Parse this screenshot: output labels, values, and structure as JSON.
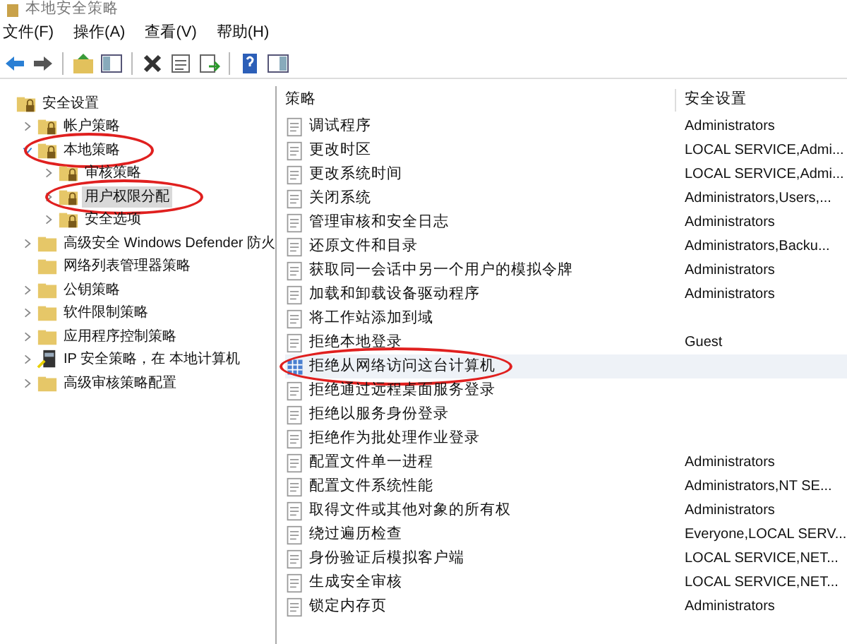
{
  "window": {
    "title": "本地安全策略"
  },
  "menu": [
    "文件(F)",
    "操作(A)",
    "查看(V)",
    "帮助(H)"
  ],
  "tree": [
    {
      "label": "安全设置",
      "kind": "lock",
      "selected": false,
      "circled": false,
      "children": [
        {
          "label": "帐户策略",
          "kind": "lock",
          "expanded": false,
          "selected": false,
          "circled": false
        },
        {
          "label": "本地策略",
          "kind": "lock",
          "expanded": true,
          "selected": false,
          "circled": true,
          "children": [
            {
              "label": "审核策略",
              "kind": "lock",
              "expanded": false,
              "selected": false,
              "circled": false
            },
            {
              "label": "用户权限分配",
              "kind": "lock",
              "expanded": false,
              "selected": true,
              "circled": true
            },
            {
              "label": "安全选项",
              "kind": "lock",
              "expanded": false,
              "selected": false,
              "circled": false
            }
          ]
        },
        {
          "label": "高级安全 Windows Defender 防火",
          "kind": "folder",
          "expanded": false,
          "selected": false,
          "circled": false
        },
        {
          "label": "网络列表管理器策略",
          "kind": "folder",
          "selected": false,
          "circled": false
        },
        {
          "label": "公钥策略",
          "kind": "folder",
          "expanded": false,
          "selected": false,
          "circled": false
        },
        {
          "label": "软件限制策略",
          "kind": "folder",
          "expanded": false,
          "selected": false,
          "circled": false
        },
        {
          "label": "应用程序控制策略",
          "kind": "folder",
          "expanded": false,
          "selected": false,
          "circled": false
        },
        {
          "label": "IP 安全策略，在 本地计算机",
          "kind": "ip",
          "expanded": false,
          "selected": false,
          "circled": false
        },
        {
          "label": "高级审核策略配置",
          "kind": "folder",
          "expanded": false,
          "selected": false,
          "circled": false
        }
      ]
    }
  ],
  "table": {
    "columns": [
      "策略",
      "安全设置"
    ],
    "rows": [
      {
        "policy": "调试程序",
        "setting": "Administrators",
        "selected": false,
        "circled": false
      },
      {
        "policy": "更改时区",
        "setting": "LOCAL SERVICE,Admi...",
        "selected": false,
        "circled": false
      },
      {
        "policy": "更改系统时间",
        "setting": "LOCAL SERVICE,Admi...",
        "selected": false,
        "circled": false
      },
      {
        "policy": "关闭系统",
        "setting": "Administrators,Users,...",
        "selected": false,
        "circled": false
      },
      {
        "policy": "管理审核和安全日志",
        "setting": "Administrators",
        "selected": false,
        "circled": false
      },
      {
        "policy": "还原文件和目录",
        "setting": "Administrators,Backu...",
        "selected": false,
        "circled": false
      },
      {
        "policy": "获取同一会话中另一个用户的模拟令牌",
        "setting": "Administrators",
        "selected": false,
        "circled": false
      },
      {
        "policy": "加载和卸载设备驱动程序",
        "setting": "Administrators",
        "selected": false,
        "circled": false
      },
      {
        "policy": "将工作站添加到域",
        "setting": "",
        "selected": false,
        "circled": false
      },
      {
        "policy": "拒绝本地登录",
        "setting": "Guest",
        "selected": false,
        "circled": false
      },
      {
        "policy": "拒绝从网络访问这台计算机",
        "setting": "",
        "selected": true,
        "circled": true
      },
      {
        "policy": "拒绝通过远程桌面服务登录",
        "setting": "",
        "selected": false,
        "circled": false
      },
      {
        "policy": "拒绝以服务身份登录",
        "setting": "",
        "selected": false,
        "circled": false
      },
      {
        "policy": "拒绝作为批处理作业登录",
        "setting": "",
        "selected": false,
        "circled": false
      },
      {
        "policy": "配置文件单一进程",
        "setting": "Administrators",
        "selected": false,
        "circled": false
      },
      {
        "policy": "配置文件系统性能",
        "setting": "Administrators,NT SE...",
        "selected": false,
        "circled": false
      },
      {
        "policy": "取得文件或其他对象的所有权",
        "setting": "Administrators",
        "selected": false,
        "circled": false
      },
      {
        "policy": "绕过遍历检查",
        "setting": "Everyone,LOCAL SERV...",
        "selected": false,
        "circled": false
      },
      {
        "policy": "身份验证后模拟客户端",
        "setting": "LOCAL SERVICE,NET...",
        "selected": false,
        "circled": false
      },
      {
        "policy": "生成安全审核",
        "setting": "LOCAL SERVICE,NET...",
        "selected": false,
        "circled": false
      },
      {
        "policy": "锁定内存页",
        "setting": "Administrators",
        "selected": false,
        "circled": false
      }
    ]
  }
}
